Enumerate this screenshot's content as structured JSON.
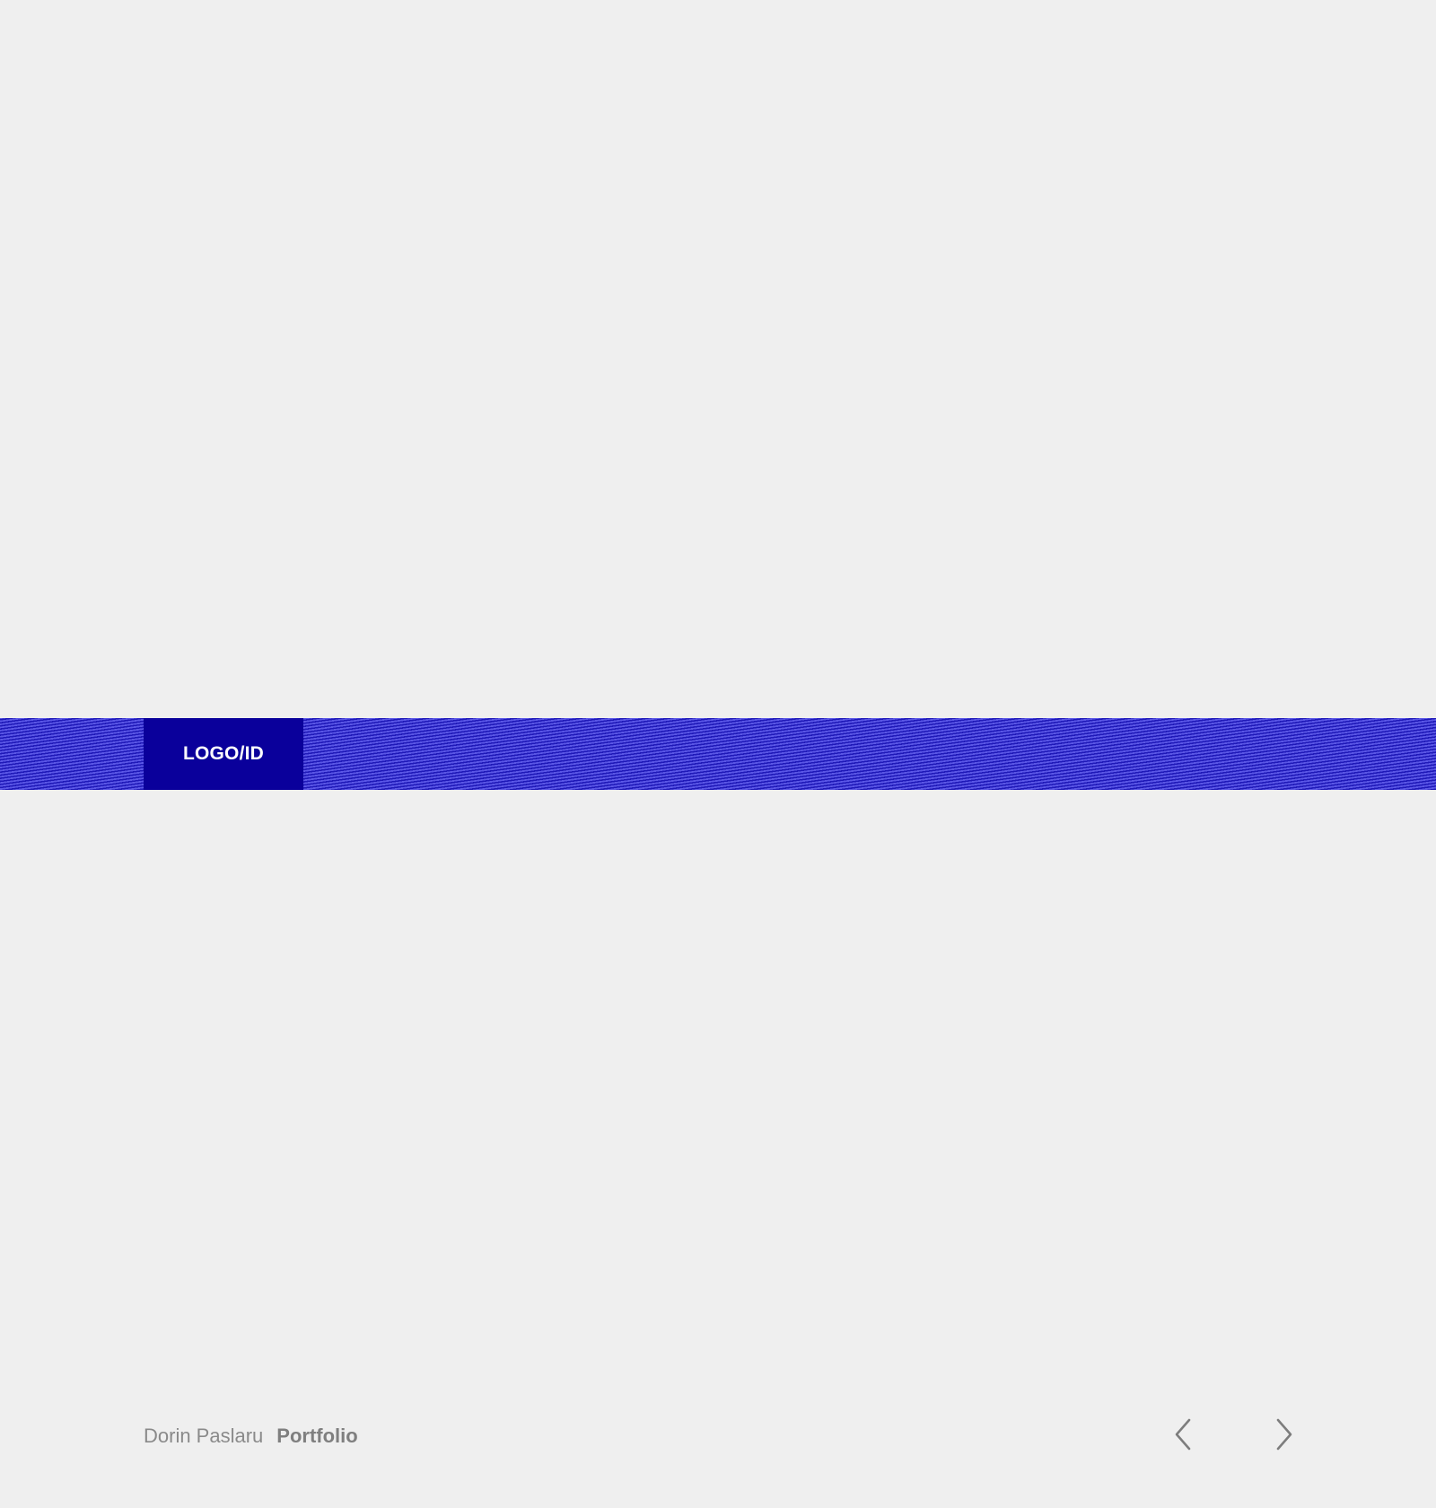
{
  "band": {
    "logo_label": "LOGO/ID",
    "colors": {
      "band_stripe_dark": "#1f19b8",
      "band_stripe_light": "#5a56e6",
      "logo_box": "#0a009b"
    }
  },
  "footer": {
    "author": "Dorin Paslaru",
    "section": "Portfolio"
  },
  "navigation": {
    "prev_icon": "chevron-left-icon",
    "next_icon": "chevron-right-icon"
  },
  "page": {
    "background": "#efefef",
    "text_gray": "#868686"
  }
}
